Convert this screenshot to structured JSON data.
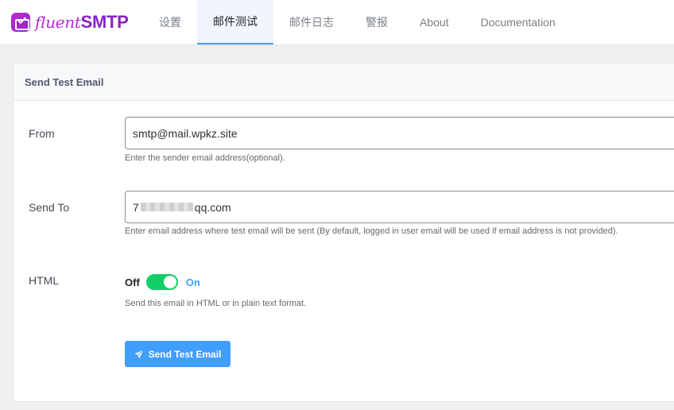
{
  "brand": {
    "logo_icon": "mail-logo-icon",
    "name_part1": "fluent",
    "name_part2": "SMTP",
    "colors": {
      "primary": "#b62bd4",
      "secondary": "#8a23c9"
    }
  },
  "nav": {
    "tabs": [
      {
        "label": "设置",
        "active": false
      },
      {
        "label": "邮件测试",
        "active": true
      },
      {
        "label": "邮件日志",
        "active": false
      },
      {
        "label": "警报",
        "active": false
      },
      {
        "label": "About",
        "active": false
      },
      {
        "label": "Documentation",
        "active": false
      }
    ]
  },
  "panel": {
    "title": "Send Test Email"
  },
  "form": {
    "from": {
      "label": "From",
      "value": "smtp@mail.wpkz.site",
      "hint": "Enter the sender email address(optional)."
    },
    "send_to": {
      "label": "Send To",
      "value_prefix": "7",
      "value_suffix": "qq.com",
      "hint": "Enter email address where test email will be sent (By default, logged in user email will be used if email address is not provided)."
    },
    "html": {
      "label": "HTML",
      "off_label": "Off",
      "on_label": "On",
      "enabled": true,
      "hint": "Send this email in HTML or in plain text format."
    },
    "submit": {
      "label": "Send Test Email",
      "icon": "paper-plane-icon"
    }
  },
  "colors": {
    "accent": "#409eff",
    "toggle_on": "#13ce66"
  }
}
